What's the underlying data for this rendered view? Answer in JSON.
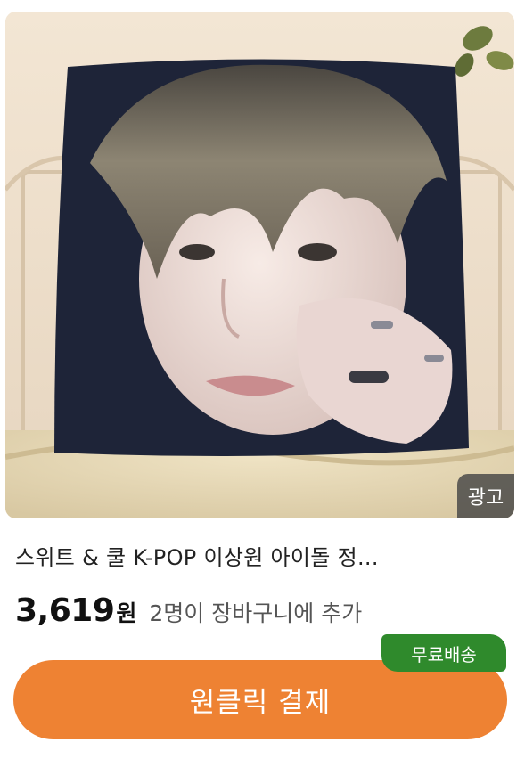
{
  "product": {
    "title": "스위트 & 쿨 K-POP 이상원 아이돌 정...",
    "ad_badge": "광고",
    "price_value": "3,619",
    "price_unit": "원",
    "cart_info": "2명이 장바구니에 추가",
    "shipping_badge": "무료배송",
    "buy_label": "원클릭 결제"
  },
  "colors": {
    "buy_button": "#ee8233",
    "shipping_badge": "#2f8a2c"
  },
  "image_alt": "cushion product photo"
}
